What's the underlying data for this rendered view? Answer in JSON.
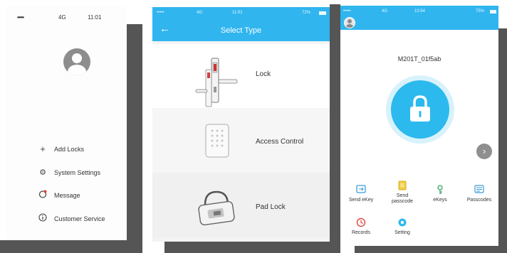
{
  "menu_screen": {
    "status_bar": {
      "signal": "•••••",
      "network": "4G",
      "time": "11:01"
    },
    "items": [
      {
        "icon": "plus-icon",
        "label": "Add Locks"
      },
      {
        "icon": "gear-icon",
        "label": "System Settings"
      },
      {
        "icon": "message-icon",
        "label": "Message"
      },
      {
        "icon": "info-icon",
        "label": "Customer Service"
      }
    ]
  },
  "select_type_screen": {
    "status_bar": {
      "signal": "•••••",
      "network": "4G",
      "time": "11:01",
      "battery": "72%"
    },
    "title": "Select Type",
    "types": [
      {
        "label": "Lock",
        "icon": "door-lock-icon"
      },
      {
        "label": "Access Control",
        "icon": "keypad-icon"
      },
      {
        "label": "Pad Lock",
        "icon": "padlock-icon"
      }
    ]
  },
  "lock_screen": {
    "status_bar": {
      "signal": "•••••",
      "network": "4G",
      "time": "10:54",
      "battery": "75%"
    },
    "lock_name": "M201T_01f5ab",
    "actions": [
      {
        "label": "Send eKey",
        "icon": "send-ekey-icon"
      },
      {
        "label": "Send passcode",
        "icon": "send-passcode-icon"
      },
      {
        "label": "eKeys",
        "icon": "ekeys-icon"
      },
      {
        "label": "Passcodes",
        "icon": "passcodes-icon"
      },
      {
        "label": "Records",
        "icon": "records-icon"
      },
      {
        "label": "Setting",
        "icon": "setting-icon"
      }
    ]
  },
  "colors": {
    "accent": "#30b5ef",
    "lock_button": "#2cb9ee",
    "backdrop": "#555555"
  }
}
